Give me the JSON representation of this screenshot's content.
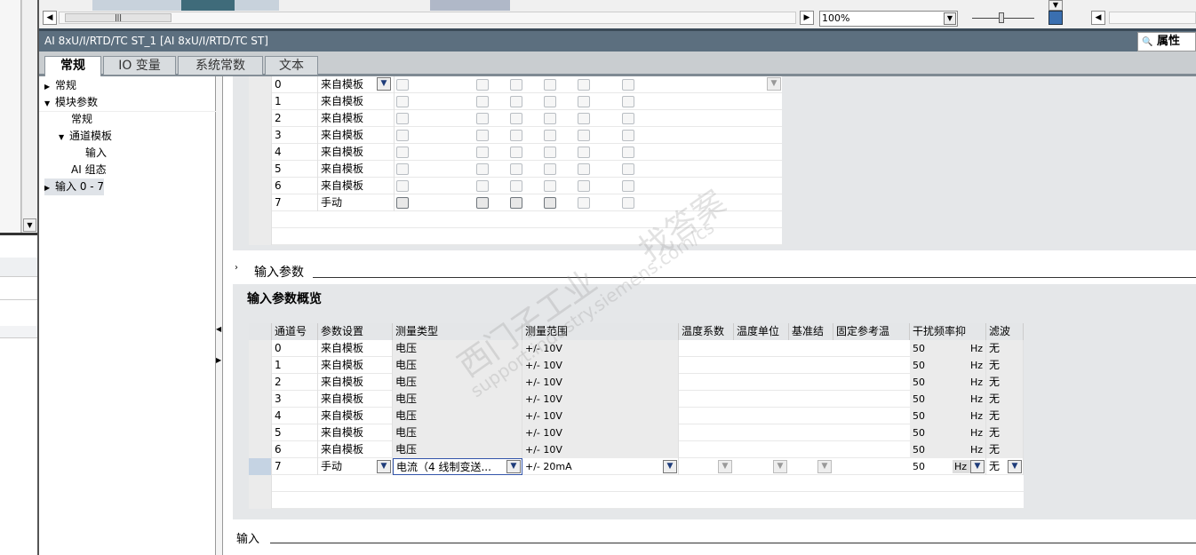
{
  "toolbar": {
    "zoom": "100%"
  },
  "title": "AI 8xU/I/RTD/TC ST_1 [AI 8xU/I/RTD/TC ST]",
  "properties_label": "属性",
  "tabs": [
    "常规",
    "IO 变量",
    "系统常数",
    "文本"
  ],
  "tree": {
    "items": [
      "常规",
      "模块参数",
      "常规",
      "通道模板",
      "输入",
      "AI 组态",
      "输入 0 - 7"
    ]
  },
  "upper_table": {
    "rows": [
      {
        "ch": "0",
        "setting": "来自模板"
      },
      {
        "ch": "1",
        "setting": "来自模板"
      },
      {
        "ch": "2",
        "setting": "来自模板"
      },
      {
        "ch": "3",
        "setting": "来自模板"
      },
      {
        "ch": "4",
        "setting": "来自模板"
      },
      {
        "ch": "5",
        "setting": "来自模板"
      },
      {
        "ch": "6",
        "setting": "来自模板"
      },
      {
        "ch": "7",
        "setting": "手动"
      }
    ]
  },
  "input_params_header": "输入参数",
  "overview_title": "输入参数概览",
  "overview_table": {
    "headers": [
      "通道号",
      "参数设置",
      "测量类型",
      "测量范围",
      "温度系数",
      "温度单位",
      "基准结",
      "固定参考温",
      "干扰频率抑",
      "滤波"
    ],
    "rows": [
      {
        "ch": "0",
        "setting": "来自模板",
        "type": "电压",
        "range": "+/- 10V",
        "freq": "50",
        "unit": "Hz",
        "filter": "无"
      },
      {
        "ch": "1",
        "setting": "来自模板",
        "type": "电压",
        "range": "+/- 10V",
        "freq": "50",
        "unit": "Hz",
        "filter": "无"
      },
      {
        "ch": "2",
        "setting": "来自模板",
        "type": "电压",
        "range": "+/- 10V",
        "freq": "50",
        "unit": "Hz",
        "filter": "无"
      },
      {
        "ch": "3",
        "setting": "来自模板",
        "type": "电压",
        "range": "+/- 10V",
        "freq": "50",
        "unit": "Hz",
        "filter": "无"
      },
      {
        "ch": "4",
        "setting": "来自模板",
        "type": "电压",
        "range": "+/- 10V",
        "freq": "50",
        "unit": "Hz",
        "filter": "无"
      },
      {
        "ch": "5",
        "setting": "来自模板",
        "type": "电压",
        "range": "+/- 10V",
        "freq": "50",
        "unit": "Hz",
        "filter": "无"
      },
      {
        "ch": "6",
        "setting": "来自模板",
        "type": "电压",
        "range": "+/- 10V",
        "freq": "50",
        "unit": "Hz",
        "filter": "无"
      },
      {
        "ch": "7",
        "setting": "手动",
        "type": "电流（4 线制变送...",
        "range": "+/- 20mA",
        "freq": "50",
        "unit": "Hz",
        "filter": "无"
      }
    ]
  },
  "bottom_section": "输入",
  "watermark": [
    "西门子工业",
    "support.industry.siemens.com/cs",
    "找答案"
  ]
}
